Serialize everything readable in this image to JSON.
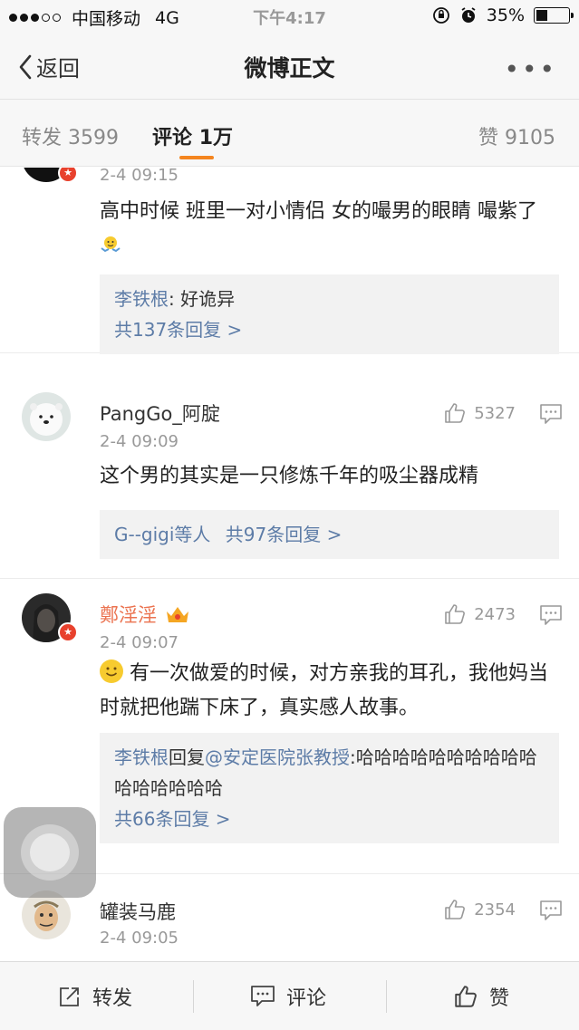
{
  "status_bar": {
    "carrier": "中国移动",
    "network": "4G",
    "time": "下午4:17",
    "battery": "35%"
  },
  "nav": {
    "back_label": "返回",
    "title": "微博正文"
  },
  "tabs": {
    "repost": "转发 3599",
    "comment_label": "评论",
    "comment_count": "1万",
    "likes": "赞 9105"
  },
  "comments": [
    {
      "time": "2-4 09:15",
      "text": "高中时候 班里一对小情侣 女的嘬男的眼睛 嘬紫了",
      "reply_user": "李铁根",
      "reply_text": ": 好诡异",
      "reply_more": "共137条回复 >"
    },
    {
      "name": "PangGo_阿腚",
      "time": "2-4 09:09",
      "likes": "5327",
      "text": "这个男的其实是一只修炼千年的吸尘器成精",
      "reply_users": "G--gigi等人",
      "reply_more": "共97条回复 >"
    },
    {
      "name": "鄭淫淫",
      "time": "2-4 09:07",
      "likes": "2473",
      "text": "有一次做爱的时候，对方亲我的耳孔，我他妈当时就把他踹下床了，真实感人故事。",
      "reply_user": "李铁根",
      "reply_mid": "回复",
      "reply_mention": "@安定医院张教授",
      "reply_text": ":哈哈哈哈哈哈哈哈哈哈哈哈哈哈哈哈",
      "reply_more": "共66条回复 >"
    },
    {
      "name": "罐装马鹿",
      "time": "2-4 09:05",
      "likes": "2354"
    }
  ],
  "bottom_bar": {
    "repost": "转发",
    "comment": "评论",
    "like": "赞"
  },
  "colors": {
    "accent": "#f4851f",
    "link": "#5d7ca7",
    "vip_name": "#eb7350",
    "badge": "#e8412d"
  },
  "icons": [
    "back-chevron-icon",
    "more-dots-icon",
    "thumb-up-icon",
    "comment-bubble-icon",
    "repost-icon",
    "verified-badge-icon"
  ]
}
